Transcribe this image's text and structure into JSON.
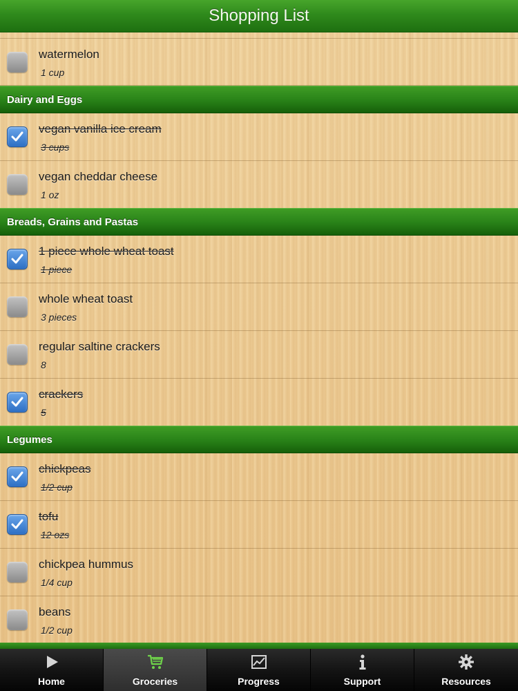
{
  "header": {
    "title": "Shopping List"
  },
  "top_item": {
    "name": "watermelon",
    "qty": "1 cup",
    "checked": false
  },
  "sections": [
    {
      "title": "Dairy and Eggs",
      "items": [
        {
          "name": "vegan vanilla ice cream",
          "qty": "3 cups",
          "checked": true
        },
        {
          "name": "vegan cheddar cheese",
          "qty": "1 oz",
          "checked": false
        }
      ]
    },
    {
      "title": "Breads, Grains and Pastas",
      "items": [
        {
          "name": "1 piece whole wheat toast",
          "qty": "1 piece",
          "checked": true
        },
        {
          "name": "whole wheat toast",
          "qty": "3 pieces",
          "checked": false
        },
        {
          "name": "regular saltine crackers",
          "qty": "8",
          "checked": false
        },
        {
          "name": "crackers",
          "qty": "5",
          "checked": true
        }
      ]
    },
    {
      "title": "Legumes",
      "items": [
        {
          "name": "chickpeas",
          "qty": "1/2 cup",
          "checked": true
        },
        {
          "name": "tofu",
          "qty": "12 ozs",
          "checked": true
        },
        {
          "name": "chickpea hummus",
          "qty": "1/4 cup",
          "checked": false
        },
        {
          "name": "beans",
          "qty": "1/2 cup",
          "checked": false
        }
      ]
    }
  ],
  "tabbar": {
    "tabs": [
      {
        "label": "Home",
        "icon": "play-icon",
        "active": false
      },
      {
        "label": "Groceries",
        "icon": "cart-icon",
        "active": true
      },
      {
        "label": "Progress",
        "icon": "chart-icon",
        "active": false
      },
      {
        "label": "Support",
        "icon": "info-icon",
        "active": false
      },
      {
        "label": "Resources",
        "icon": "gear-icon",
        "active": false
      }
    ]
  },
  "colors": {
    "header_green": "#2f8a1c",
    "checkbox_checked": "#2d6fc4",
    "checkbox_unchecked": "#9a9a9a",
    "tabbar": "#141414"
  }
}
